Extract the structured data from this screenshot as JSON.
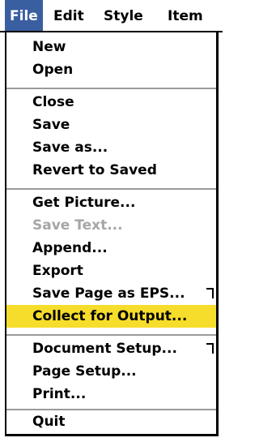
{
  "menubar": {
    "items": [
      {
        "label": "File"
      },
      {
        "label": "Edit"
      },
      {
        "label": "Style"
      },
      {
        "label": "Item"
      }
    ]
  },
  "file_menu": {
    "items": [
      {
        "label": "New"
      },
      {
        "label": "Open"
      },
      {
        "label": "Close"
      },
      {
        "label": "Save"
      },
      {
        "label": "Save as..."
      },
      {
        "label": "Revert to Saved"
      },
      {
        "label": "Get Picture..."
      },
      {
        "label": "Save Text..."
      },
      {
        "label": "Append..."
      },
      {
        "label": "Export"
      },
      {
        "label": "Save Page as EPS..."
      },
      {
        "label": "Collect for Output..."
      },
      {
        "label": "Document Setup..."
      },
      {
        "label": "Page Setup..."
      },
      {
        "label": "Print..."
      },
      {
        "label": "Quit"
      }
    ],
    "disabled_item": "Save Text...",
    "highlighted_item": "Collect for Output...",
    "submenu_icon": "submenu-hook-icon"
  },
  "colors": {
    "menubar_active_bg": "#3a5fa0",
    "highlight_bg": "#f7dd2b",
    "disabled_text": "#a6a6a6",
    "separator": "#9a9a9a"
  }
}
